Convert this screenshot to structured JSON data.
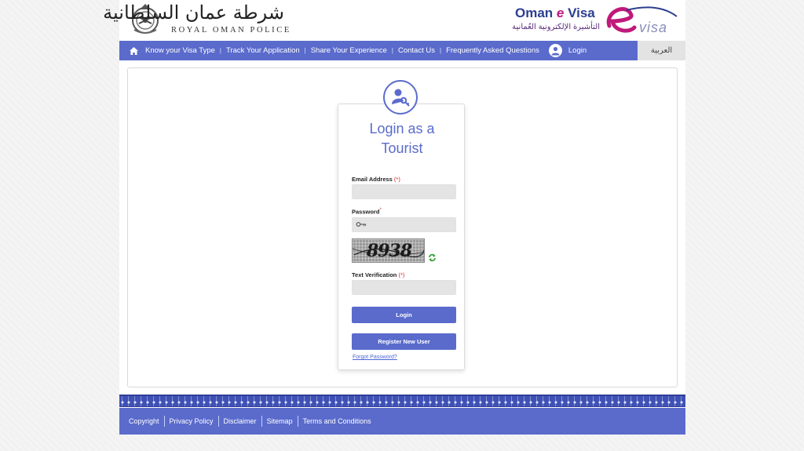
{
  "header": {
    "rop_arabic": "شرطة عمان السلطانية",
    "rop_english": "ROYAL OMAN POLICE",
    "evisa_title_prefix": "Oman ",
    "evisa_title_e": "e",
    "evisa_title_suffix": " Visa",
    "evisa_arabic": "التأشيرة الإلكترونية العُمانية",
    "evisa_logo_text": "visa"
  },
  "nav": {
    "items": [
      "Know your Visa Type",
      "Track Your Application",
      "Share Your Experience",
      "Contact Us",
      "Frequently Asked Questions"
    ],
    "separator": "|",
    "login_label": "Login",
    "language_label": "العربية"
  },
  "login_form": {
    "title_line1": "Login as a",
    "title_line2": "Tourist",
    "email_label": "Email Address",
    "email_req": "(*)",
    "password_label": "Password",
    "password_req": "*",
    "captcha_text": "8938",
    "verification_label": "Text Verification",
    "verification_req": "(*)",
    "login_button": "Login",
    "register_button": "Register New User",
    "forgot_link": "Forgot Password?"
  },
  "footer": {
    "links": [
      "Copyright",
      "Privacy Policy",
      "Disclaimer",
      "Sitemap",
      "Terms and Conditions"
    ]
  },
  "colors": {
    "primary": "#5a6bcc",
    "footer_pattern": "#3f51b5",
    "required": "#e02020",
    "link": "#4a66d6"
  },
  "icons": [
    "rop-emblem-icon",
    "evisa-logo-icon",
    "home-icon",
    "user-icon",
    "tourist-key-icon",
    "key-icon",
    "refresh-icon"
  ]
}
